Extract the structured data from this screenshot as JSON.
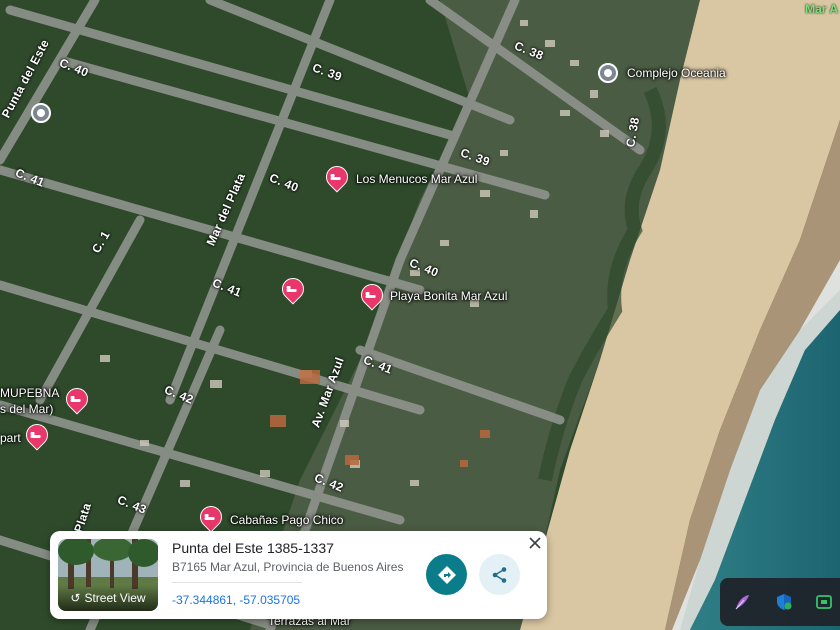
{
  "map": {
    "corner_label": "Mar A",
    "streets": [
      {
        "id": "c40-a",
        "text": "C. 40"
      },
      {
        "id": "c39-a",
        "text": "C. 39"
      },
      {
        "id": "c38-a",
        "text": "C. 38"
      },
      {
        "id": "c39-b",
        "text": "C. 39"
      },
      {
        "id": "c38-b",
        "text": "C. 38"
      },
      {
        "id": "punta-del-este",
        "text": "Punta del Este"
      },
      {
        "id": "c41-a",
        "text": "C. 41"
      },
      {
        "id": "c40-b",
        "text": "C. 40"
      },
      {
        "id": "mar-del-plata-a",
        "text": "Mar del Plata"
      },
      {
        "id": "c1",
        "text": "C. 1"
      },
      {
        "id": "c41-b",
        "text": "C. 41"
      },
      {
        "id": "c40-c",
        "text": "C. 40"
      },
      {
        "id": "c41-c",
        "text": "C. 41"
      },
      {
        "id": "c42-a",
        "text": "C. 42"
      },
      {
        "id": "av-mar-azul",
        "text": "Av. Mar Azul"
      },
      {
        "id": "c43",
        "text": "C. 43"
      },
      {
        "id": "c42-b",
        "text": "C. 42"
      },
      {
        "id": "plata",
        "text": "Plata"
      }
    ],
    "places": [
      {
        "id": "complejo-oceania",
        "name": "Complejo Oceania"
      },
      {
        "id": "los-menucos",
        "name": "Los Menucos Mar Azul"
      },
      {
        "id": "playa-bonita",
        "name": "Playa Bonita Mar Azul"
      },
      {
        "id": "mupebna",
        "name": "MUPEBNA"
      },
      {
        "id": "mupebna-sub",
        "name": "s del Mar)"
      },
      {
        "id": "apart",
        "name": "part"
      },
      {
        "id": "cabanas-pago-chico",
        "name": "Cabañas Pago Chico"
      },
      {
        "id": "terrazas",
        "name": "Terrazas al Mar"
      }
    ]
  },
  "card": {
    "title": "Punta del Este 1385-1337",
    "address": "B7165 Mar Azul, Provincia de Buenos Aires",
    "coordinates": "-37.344861, -57.035705",
    "street_view_label": "Street View",
    "directions_icon": "directions-icon",
    "share_icon": "share-icon",
    "close_icon": "close-icon"
  },
  "tray": {
    "icons": [
      "feather-icon",
      "shield-icon",
      "app-icon"
    ]
  },
  "colors": {
    "hotel_pin": "#e8386b",
    "directions_button": "#0b7c89",
    "link": "#1a73e8"
  }
}
